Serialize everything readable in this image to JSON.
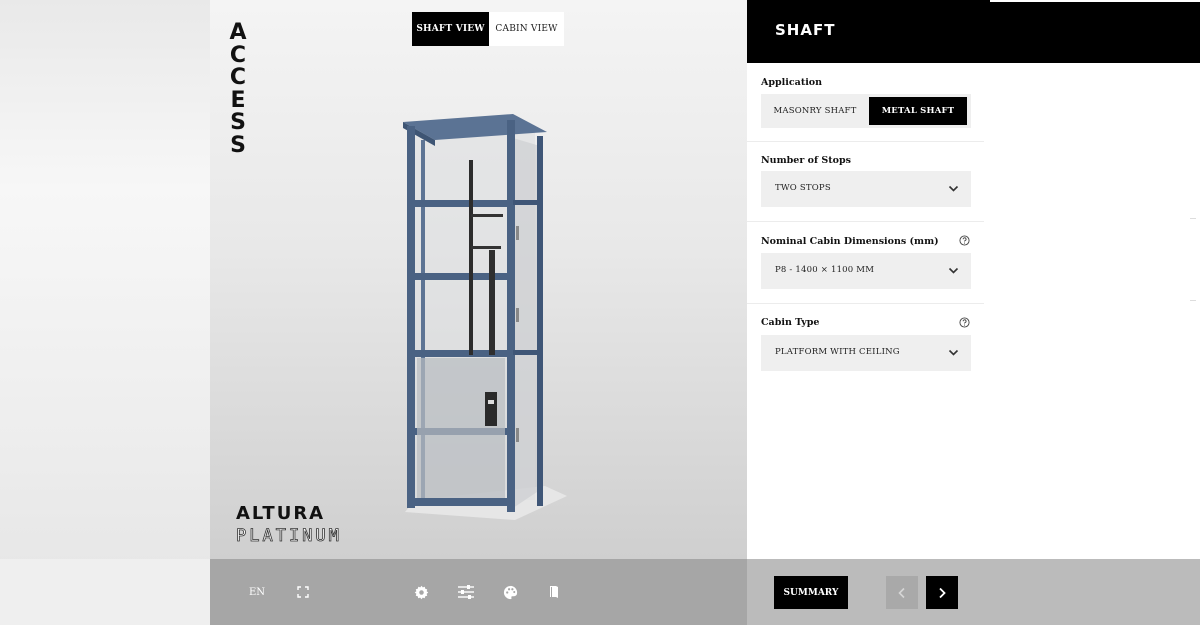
{
  "brand": {
    "vertical_letters": [
      "A",
      "C",
      "C",
      "E",
      "S",
      "S"
    ],
    "model_line1": "ALTURA",
    "model_line2": "PLATINUM"
  },
  "viewer": {
    "shaft_view_label": "SHAFT VIEW",
    "cabin_view_label": "CABIN VIEW",
    "active_view": "SHAFT VIEW"
  },
  "toolbar": {
    "language": "EN",
    "icons": [
      "fullscreen-icon",
      "gear-icon",
      "sliders-icon",
      "palette-icon",
      "book-icon"
    ]
  },
  "panel": {
    "title": "SHAFT",
    "application": {
      "label": "Application",
      "options": [
        "MASONRY SHAFT",
        "METAL SHAFT"
      ],
      "selected": "METAL SHAFT"
    },
    "stops": {
      "label": "Number of Stops",
      "value": "TWO STOPS"
    },
    "dimensions": {
      "label": "Nominal Cabin Dimensions (mm)",
      "value": "P8 - 1400 × 1100 MM"
    },
    "cabin_type": {
      "label": "Cabin Type",
      "value": "PLATFORM WITH CEILING"
    }
  },
  "nav": {
    "summary_label": "SUMMARY"
  },
  "colors": {
    "frame": "#4a6283",
    "accent": "#000000",
    "toolbar": "#a6a6a6",
    "dropdown_bg": "#efefef"
  }
}
